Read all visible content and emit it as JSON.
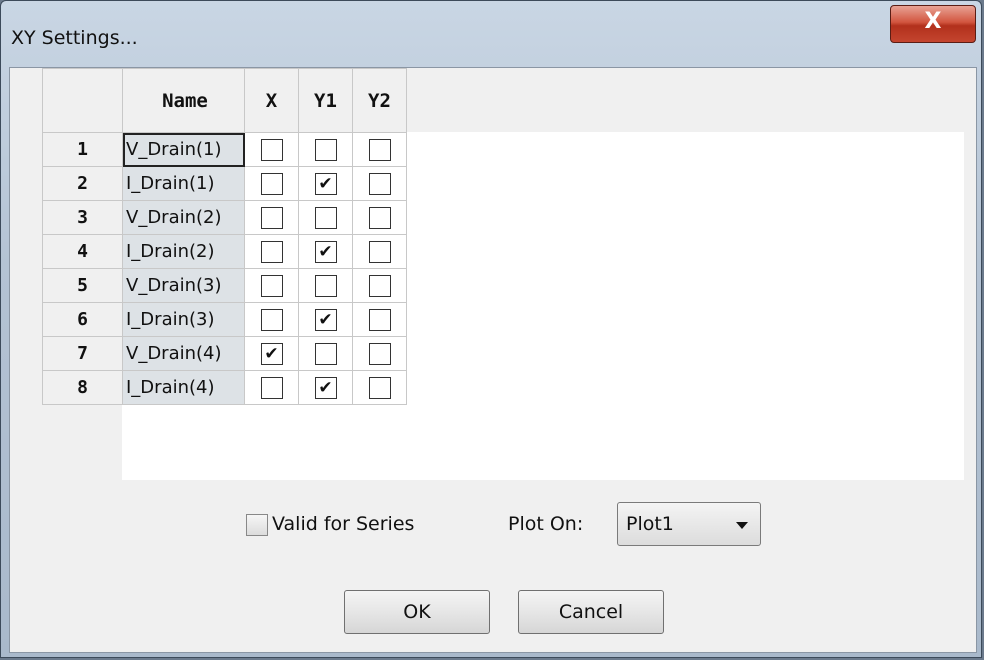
{
  "window": {
    "title": "XY Settings...",
    "close_glyph": "X"
  },
  "grid": {
    "headers": {
      "row": "",
      "name": "Name",
      "x": "X",
      "y1": "Y1",
      "y2": "Y2"
    },
    "rows": [
      {
        "index": "1",
        "name": "V_Drain(1)",
        "x": false,
        "y1": false,
        "y2": false
      },
      {
        "index": "2",
        "name": "I_Drain(1)",
        "x": false,
        "y1": true,
        "y2": false
      },
      {
        "index": "3",
        "name": "V_Drain(2)",
        "x": false,
        "y1": false,
        "y2": false
      },
      {
        "index": "4",
        "name": "I_Drain(2)",
        "x": false,
        "y1": true,
        "y2": false
      },
      {
        "index": "5",
        "name": "V_Drain(3)",
        "x": false,
        "y1": false,
        "y2": false
      },
      {
        "index": "6",
        "name": "I_Drain(3)",
        "x": false,
        "y1": true,
        "y2": false
      },
      {
        "index": "7",
        "name": "V_Drain(4)",
        "x": true,
        "y1": false,
        "y2": false
      },
      {
        "index": "8",
        "name": "I_Drain(4)",
        "x": false,
        "y1": true,
        "y2": false
      }
    ]
  },
  "valid_for_series": {
    "label": "Valid for Series",
    "checked": false
  },
  "plot_on": {
    "label": "Plot On:",
    "selected": "Plot1"
  },
  "buttons": {
    "ok": "OK",
    "cancel": "Cancel"
  },
  "check_glyph": "✔"
}
